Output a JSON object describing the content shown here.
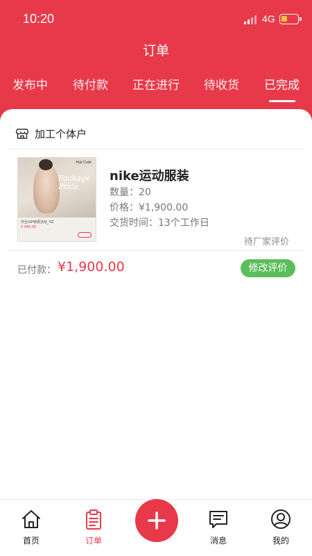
{
  "status_bar": {
    "time": "10:20",
    "network": "4G"
  },
  "header": {
    "title": "订单"
  },
  "tabs": [
    {
      "label": "发布中"
    },
    {
      "label": "待付款"
    },
    {
      "label": "正在进行"
    },
    {
      "label": "待收货"
    },
    {
      "label": "已完成",
      "active": true
    }
  ],
  "order": {
    "shop_name": "加工个体户",
    "product_name": "nike运动服装",
    "quantity": "数量：20",
    "price": "价格：¥1,900.00",
    "delivery": "交货时间：13个工作日",
    "status": "待厂家评价",
    "paid_label": "已付款：",
    "paid_amount": "¥1,900.00",
    "action_label": "修改评价",
    "thumbnail": {
      "brand": "Hair Code",
      "script": "Package Price",
      "caption": "开业VIP特惠活动_HZ",
      "price": "¥ 440.00"
    }
  },
  "bottom_nav": [
    {
      "label": "首页",
      "icon": "home-icon"
    },
    {
      "label": "订单",
      "icon": "clipboard-icon",
      "active": true
    },
    {
      "label": "消息",
      "icon": "message-icon"
    },
    {
      "label": "我的",
      "icon": "profile-icon"
    }
  ],
  "colors": {
    "brand": "#e8394a",
    "action": "#5cbe5a"
  }
}
